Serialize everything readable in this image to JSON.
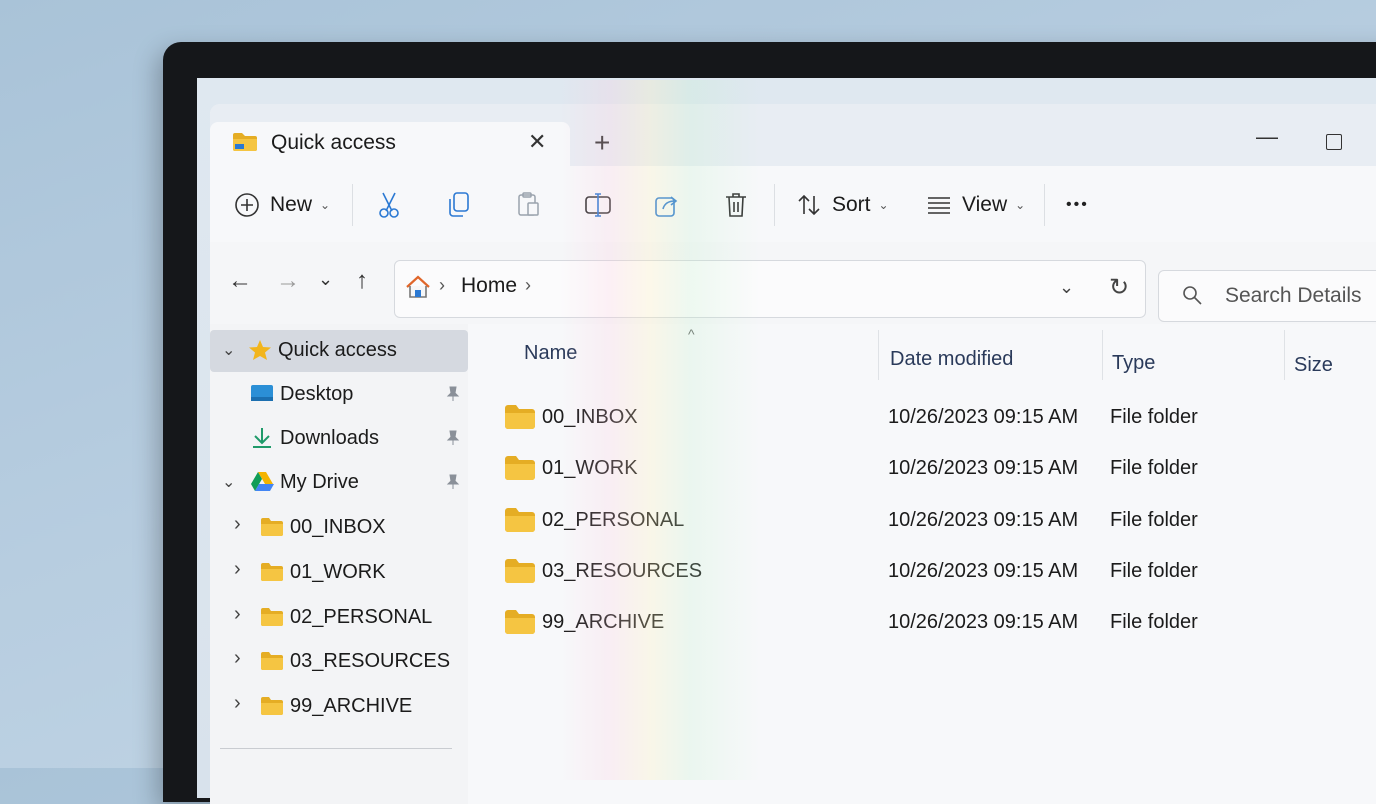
{
  "window": {
    "tab_title": "Quick access",
    "close_tab": "✕",
    "new_tab": "+",
    "minimize": "—"
  },
  "toolbar": {
    "new_label": "New",
    "sort_label": "Sort",
    "view_label": "View",
    "more_label": "•••",
    "chevron": "⌄"
  },
  "nav": {
    "back": "←",
    "forward": "→",
    "recent": "⌄",
    "up": "↑",
    "breadcrumb": "Home",
    "breadcrumb_sep": "›",
    "address_dropdown": "⌄",
    "refresh": "↻"
  },
  "search": {
    "placeholder": "Search Details"
  },
  "sidebar": {
    "items": [
      {
        "label": "Quick access",
        "icon": "star-icon",
        "expanded": true,
        "selected": true
      },
      {
        "label": "Desktop",
        "icon": "desktop-icon",
        "pinned": true
      },
      {
        "label": "Downloads",
        "icon": "download-icon",
        "pinned": true
      },
      {
        "label": "My Drive",
        "icon": "google-drive-icon",
        "expanded": true,
        "pinned": true
      },
      {
        "label": "00_INBOX",
        "icon": "folder-icon"
      },
      {
        "label": "01_WORK",
        "icon": "folder-icon"
      },
      {
        "label": "02_PERSONAL",
        "icon": "folder-icon"
      },
      {
        "label": "03_RESOURCES",
        "icon": "folder-icon"
      },
      {
        "label": "99_ARCHIVE",
        "icon": "folder-icon"
      }
    ],
    "expand_chevron": "⌄",
    "collapse_chevron": "›"
  },
  "columns": {
    "name": "Name",
    "date": "Date modified",
    "type": "Type",
    "size": "Size"
  },
  "files": [
    {
      "name": "00_INBOX",
      "date": "10/26/2023 09:15 AM",
      "type": "File folder"
    },
    {
      "name": "01_WORK",
      "date": "10/26/2023 09:15 AM",
      "type": "File folder"
    },
    {
      "name": "02_PERSONAL",
      "date": "10/26/2023 09:15 AM",
      "type": "File folder"
    },
    {
      "name": "03_RESOURCES",
      "date": "10/26/2023 09:15 AM",
      "type": "File folder"
    },
    {
      "name": "99_ARCHIVE",
      "date": "10/26/2023 09:15 AM",
      "type": "File folder"
    }
  ],
  "colors": {
    "folder": "#f5c542",
    "folder_dark": "#e5ad24",
    "accent": "#0067c0",
    "selected": "#d5d9e0"
  }
}
